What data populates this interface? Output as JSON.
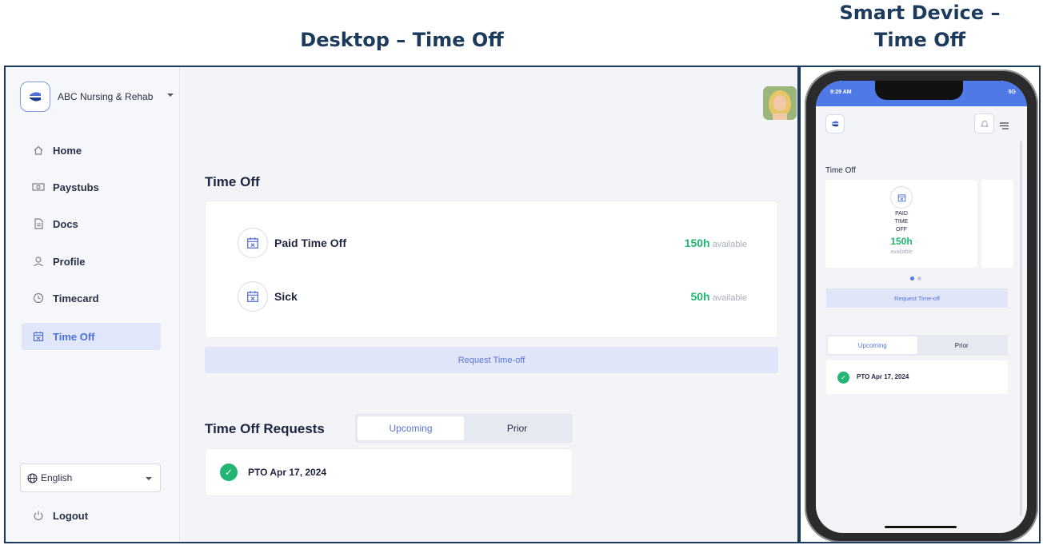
{
  "headings": {
    "desktop": "Desktop – Time Off",
    "smart_line1": "Smart Device –",
    "smart_line2": "Time Off"
  },
  "desktop": {
    "org_name": "ABC Nursing & Rehab",
    "nav": [
      {
        "label": "Home",
        "icon": "home-icon"
      },
      {
        "label": "Paystubs",
        "icon": "cash-icon"
      },
      {
        "label": "Docs",
        "icon": "document-icon"
      },
      {
        "label": "Profile",
        "icon": "user-icon"
      },
      {
        "label": "Timecard",
        "icon": "clock-icon"
      },
      {
        "label": "Time Off",
        "icon": "calendar-x-icon",
        "active": true
      }
    ],
    "language": "English",
    "logout": "Logout",
    "section_title": "Time Off",
    "balances": [
      {
        "label": "Paid Time Off",
        "value": "150h",
        "suffix": "available"
      },
      {
        "label": "Sick",
        "value": "50h",
        "suffix": "available"
      }
    ],
    "request_button": "Request Time-off",
    "requests_title": "Time Off Requests",
    "tabs": [
      "Upcoming",
      "Prior"
    ],
    "active_tab": "Upcoming",
    "requests": [
      {
        "label": "PTO Apr 17, 2024",
        "status": "approved"
      }
    ]
  },
  "mobile": {
    "status_time": "9:29 AM",
    "status_signal": "5G",
    "section_title": "Time Off",
    "card": {
      "line1": "PAID",
      "line2": "TIME",
      "line3": "OFF",
      "value": "150h",
      "suffix": "available"
    },
    "request_button": "Request Time-off",
    "tabs": [
      "Upcoming",
      "Prior"
    ],
    "requests": [
      {
        "label": "PTO Apr 17, 2024"
      }
    ]
  },
  "colors": {
    "accent": "#4f6fd8",
    "success": "#22b573",
    "heading": "#1b3a5c"
  }
}
